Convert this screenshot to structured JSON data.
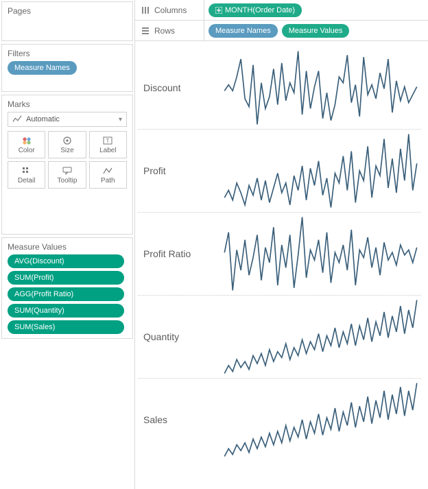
{
  "left": {
    "pages_title": "Pages",
    "filters_title": "Filters",
    "filter_pill": "Measure Names",
    "marks_title": "Marks",
    "marks_type": "Automatic",
    "mark_btns": {
      "color": "Color",
      "size": "Size",
      "label": "Label",
      "detail": "Detail",
      "tooltip": "Tooltip",
      "path": "Path"
    },
    "measure_values_title": "Measure Values",
    "measure_values": [
      "AVG(Discount)",
      "SUM(Profit)",
      "AGG(Profit Ratio)",
      "SUM(Quantity)",
      "SUM(Sales)"
    ]
  },
  "shelves": {
    "columns_label": "Columns",
    "rows_label": "Rows",
    "columns_pill": "MONTH(Order Date)",
    "rows_pill_1": "Measure Names",
    "rows_pill_2": "Measure Values"
  },
  "chart_data": [
    {
      "name": "Discount",
      "type": "line",
      "values": [
        52,
        58,
        52,
        66,
        84,
        44,
        36,
        78,
        18,
        60,
        34,
        46,
        74,
        38,
        80,
        42,
        60,
        50,
        92,
        28,
        72,
        34,
        56,
        72,
        24,
        50,
        22,
        38,
        66,
        60,
        88,
        40,
        58,
        26,
        86,
        48,
        58,
        44,
        70,
        54,
        84,
        30,
        62,
        42,
        56,
        40,
        48,
        56
      ]
    },
    {
      "name": "Profit",
      "type": "line",
      "values": [
        32,
        38,
        30,
        44,
        36,
        26,
        42,
        34,
        48,
        30,
        46,
        28,
        40,
        52,
        36,
        44,
        26,
        50,
        38,
        58,
        30,
        56,
        42,
        62,
        34,
        48,
        24,
        52,
        44,
        66,
        38,
        70,
        28,
        54,
        46,
        74,
        32,
        58,
        50,
        80,
        40,
        64,
        36,
        72,
        46,
        84,
        38,
        60
      ]
    },
    {
      "name": "Profit Ratio",
      "type": "line",
      "values": [
        56,
        72,
        26,
        58,
        42,
        66,
        38,
        52,
        70,
        34,
        60,
        48,
        76,
        30,
        62,
        44,
        70,
        28,
        54,
        84,
        36,
        58,
        50,
        66,
        40,
        72,
        32,
        56,
        48,
        62,
        42,
        74,
        30,
        58,
        52,
        68,
        44,
        60,
        38,
        64,
        50,
        56,
        46,
        62,
        54,
        58,
        48,
        60
      ]
    },
    {
      "name": "Quantity",
      "type": "line",
      "values": [
        18,
        26,
        20,
        32,
        24,
        30,
        22,
        36,
        28,
        38,
        26,
        42,
        30,
        40,
        34,
        48,
        32,
        44,
        36,
        52,
        38,
        50,
        42,
        58,
        40,
        56,
        46,
        64,
        44,
        60,
        48,
        68,
        46,
        66,
        52,
        74,
        50,
        70,
        56,
        80,
        54,
        76,
        60,
        86,
        58,
        82,
        64,
        92
      ]
    },
    {
      "name": "Sales",
      "type": "line",
      "values": [
        22,
        30,
        24,
        34,
        28,
        36,
        26,
        40,
        30,
        42,
        32,
        46,
        34,
        48,
        36,
        54,
        38,
        52,
        42,
        60,
        40,
        58,
        46,
        66,
        44,
        62,
        50,
        72,
        48,
        68,
        54,
        78,
        52,
        74,
        58,
        84,
        56,
        80,
        62,
        90,
        60,
        86,
        66,
        94,
        64,
        90,
        70,
        98
      ]
    }
  ]
}
